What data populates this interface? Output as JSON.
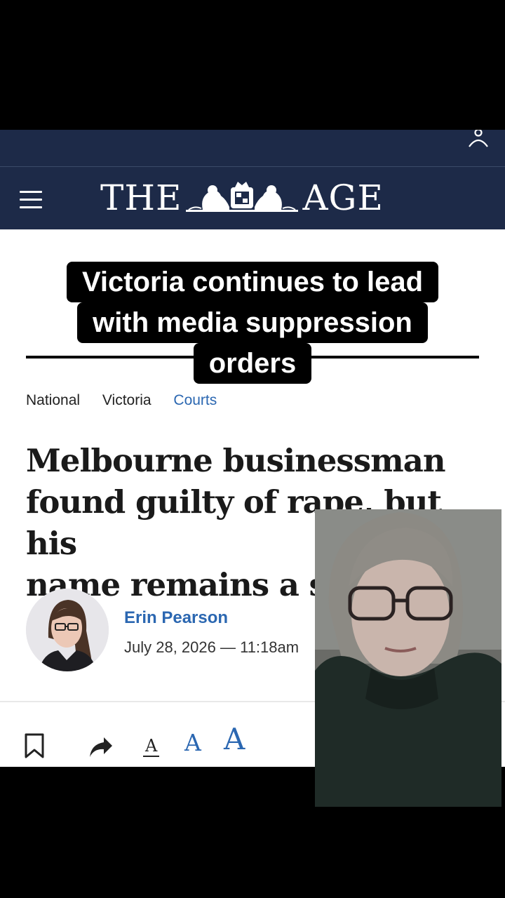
{
  "header": {
    "logo_left": "THE",
    "logo_right": "AGE",
    "menu_icon": "hamburger-menu-icon",
    "account_icon": "user-account-icon",
    "bg_color": "#1d2a48"
  },
  "overlay_caption": {
    "line1": "Victoria continues to lead",
    "line2": "with media suppression",
    "line3": "orders"
  },
  "article": {
    "breadcrumbs": [
      "National",
      "Victoria",
      "Courts"
    ],
    "headline_line1": "Melbourne businessman",
    "headline_line2": "found guilty of rape, but his",
    "headline_line3": "name remains a sec",
    "author": "Erin Pearson",
    "dateline": "July 28, 2026 — 11:18am",
    "accent_color": "#2b67b1"
  },
  "toolbar": {
    "bookmark_icon": "bookmark-icon",
    "share_icon": "share-icon",
    "font_size_small": "A",
    "font_size_medium": "A",
    "font_size_large": "A"
  }
}
